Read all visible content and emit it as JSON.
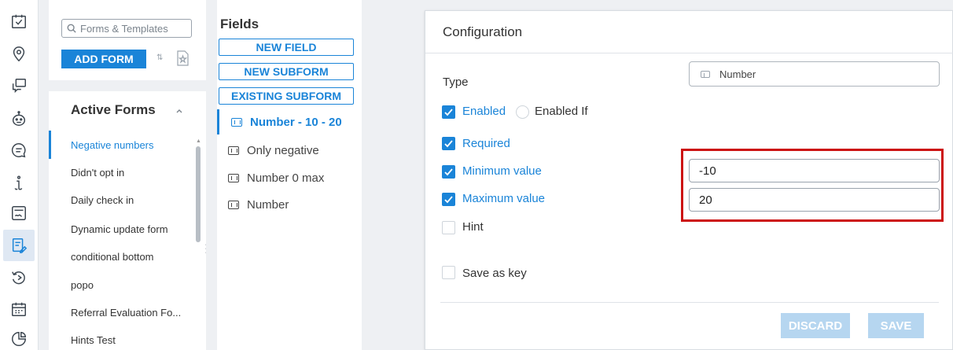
{
  "rail": {
    "icons": [
      "calendar-check-icon",
      "location-pin-icon",
      "chat-bubbles-icon",
      "bot-icon",
      "message-icon",
      "info-icon",
      "form-signature-icon",
      "form-edit-icon",
      "undo-clock-icon",
      "calendar-grid-icon",
      "pie-chart-icon"
    ],
    "active_index": 7
  },
  "forms": {
    "search_placeholder": "Forms & Templates",
    "add_button": "ADD FORM",
    "section_title": "Active Forms",
    "items": [
      "Negative numbers",
      "Didn't opt in",
      "Daily check in",
      "Dynamic update form",
      "conditional bottom",
      "popo",
      "Referral Evaluation Fo...",
      "Hints Test"
    ],
    "selected_index": 0
  },
  "fields": {
    "title": "Fields",
    "new_field": "NEW FIELD",
    "new_subform": "NEW SUBFORM",
    "existing_subform": "EXISTING SUBFORM",
    "items": [
      "Number - 10 - 20",
      "Only negative",
      "Number 0 max",
      "Number"
    ],
    "selected_index": 0
  },
  "config": {
    "title": "Configuration",
    "type_label": "Type",
    "type_value": "Number",
    "enabled_label": "Enabled",
    "enabled_if_label": "Enabled If",
    "required_label": "Required",
    "min_label": "Minimum value",
    "min_value": "-10",
    "max_label": "Maximum value",
    "max_value": "20",
    "hint_label": "Hint",
    "save_key_label": "Save as key",
    "discard_button": "DISCARD",
    "save_button": "SAVE"
  },
  "colors": {
    "accent": "#1a84d8",
    "highlight": "#cc1010",
    "disabled_button": "#b6d6f0"
  }
}
